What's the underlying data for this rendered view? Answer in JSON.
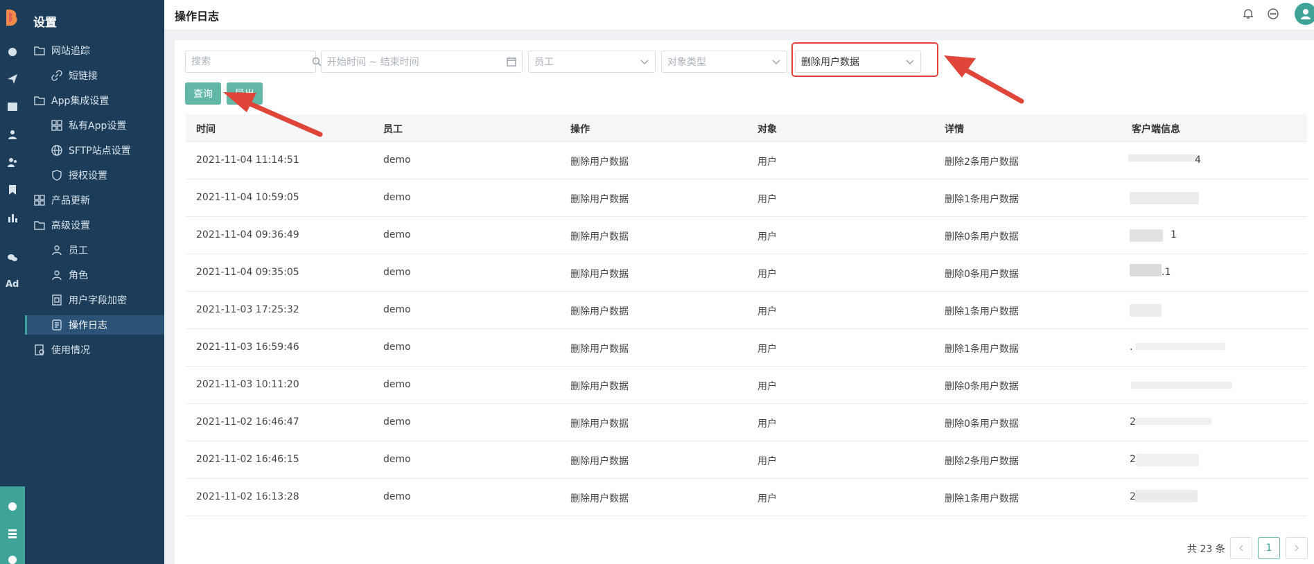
{
  "header": {
    "page_title": "操作日志"
  },
  "sidebar": {
    "title": "设置",
    "items": [
      {
        "label": "网站追踪",
        "icon": "folder-icon"
      },
      {
        "label": "短链接",
        "icon": "link-icon"
      },
      {
        "label": "App集成设置",
        "icon": "folder-icon"
      },
      {
        "label": "私有App设置",
        "icon": "grid-icon"
      },
      {
        "label": "SFTP站点设置",
        "icon": "globe-icon"
      },
      {
        "label": "授权设置",
        "icon": "shield-icon"
      },
      {
        "label": "产品更新",
        "icon": "grid-icon"
      },
      {
        "label": "高级设置",
        "icon": "folder-icon"
      },
      {
        "label": "员工",
        "icon": "user-icon"
      },
      {
        "label": "角色",
        "icon": "user-icon"
      },
      {
        "label": "用户字段加密",
        "icon": "document-icon"
      },
      {
        "label": "操作日志",
        "icon": "log-icon"
      },
      {
        "label": "使用情况",
        "icon": "report-icon"
      }
    ],
    "active_item": "操作日志"
  },
  "rail": {
    "ad_label": "Ad"
  },
  "filters": {
    "search_placeholder": "搜索",
    "date_range_placeholder": "开始时间 ~ 结束时间",
    "employee_placeholder": "员工",
    "object_type_placeholder": "对象类型",
    "operation_value": "删除用户数据"
  },
  "buttons": {
    "query": "查询",
    "export": "导出"
  },
  "table": {
    "columns": [
      "时间",
      "员工",
      "操作",
      "对象",
      "详情",
      "客户端信息"
    ],
    "rows": [
      {
        "time": "2021-11-04 11:14:51",
        "employee": "demo",
        "operation": "删除用户数据",
        "object": "用户",
        "detail": "删除2条用户数据",
        "client": "4"
      },
      {
        "time": "2021-11-04 10:59:05",
        "employee": "demo",
        "operation": "删除用户数据",
        "object": "用户",
        "detail": "删除1条用户数据",
        "client": ""
      },
      {
        "time": "2021-11-04 09:36:49",
        "employee": "demo",
        "operation": "删除用户数据",
        "object": "用户",
        "detail": "删除0条用户数据",
        "client": "1"
      },
      {
        "time": "2021-11-04 09:35:05",
        "employee": "demo",
        "operation": "删除用户数据",
        "object": "用户",
        "detail": "删除0条用户数据",
        "client": ".1"
      },
      {
        "time": "2021-11-03 17:25:32",
        "employee": "demo",
        "operation": "删除用户数据",
        "object": "用户",
        "detail": "删除1条用户数据",
        "client": ""
      },
      {
        "time": "2021-11-03 16:59:46",
        "employee": "demo",
        "operation": "删除用户数据",
        "object": "用户",
        "detail": "删除1条用户数据",
        "client": "."
      },
      {
        "time": "2021-11-03 10:11:20",
        "employee": "demo",
        "operation": "删除用户数据",
        "object": "用户",
        "detail": "删除0条用户数据",
        "client": ""
      },
      {
        "time": "2021-11-02 16:46:47",
        "employee": "demo",
        "operation": "删除用户数据",
        "object": "用户",
        "detail": "删除0条用户数据",
        "client": "2"
      },
      {
        "time": "2021-11-02 16:46:15",
        "employee": "demo",
        "operation": "删除用户数据",
        "object": "用户",
        "detail": "删除2条用户数据",
        "client": "2"
      },
      {
        "time": "2021-11-02 16:13:28",
        "employee": "demo",
        "operation": "删除用户数据",
        "object": "用户",
        "detail": "删除1条用户数据",
        "client": "2"
      }
    ]
  },
  "pagination": {
    "total_text": "共 23 条",
    "current_page": "1"
  },
  "colors": {
    "sidebar_bg": "#1c3d5a",
    "accent": "#63b7a7",
    "annotation_red": "#e0453a"
  }
}
